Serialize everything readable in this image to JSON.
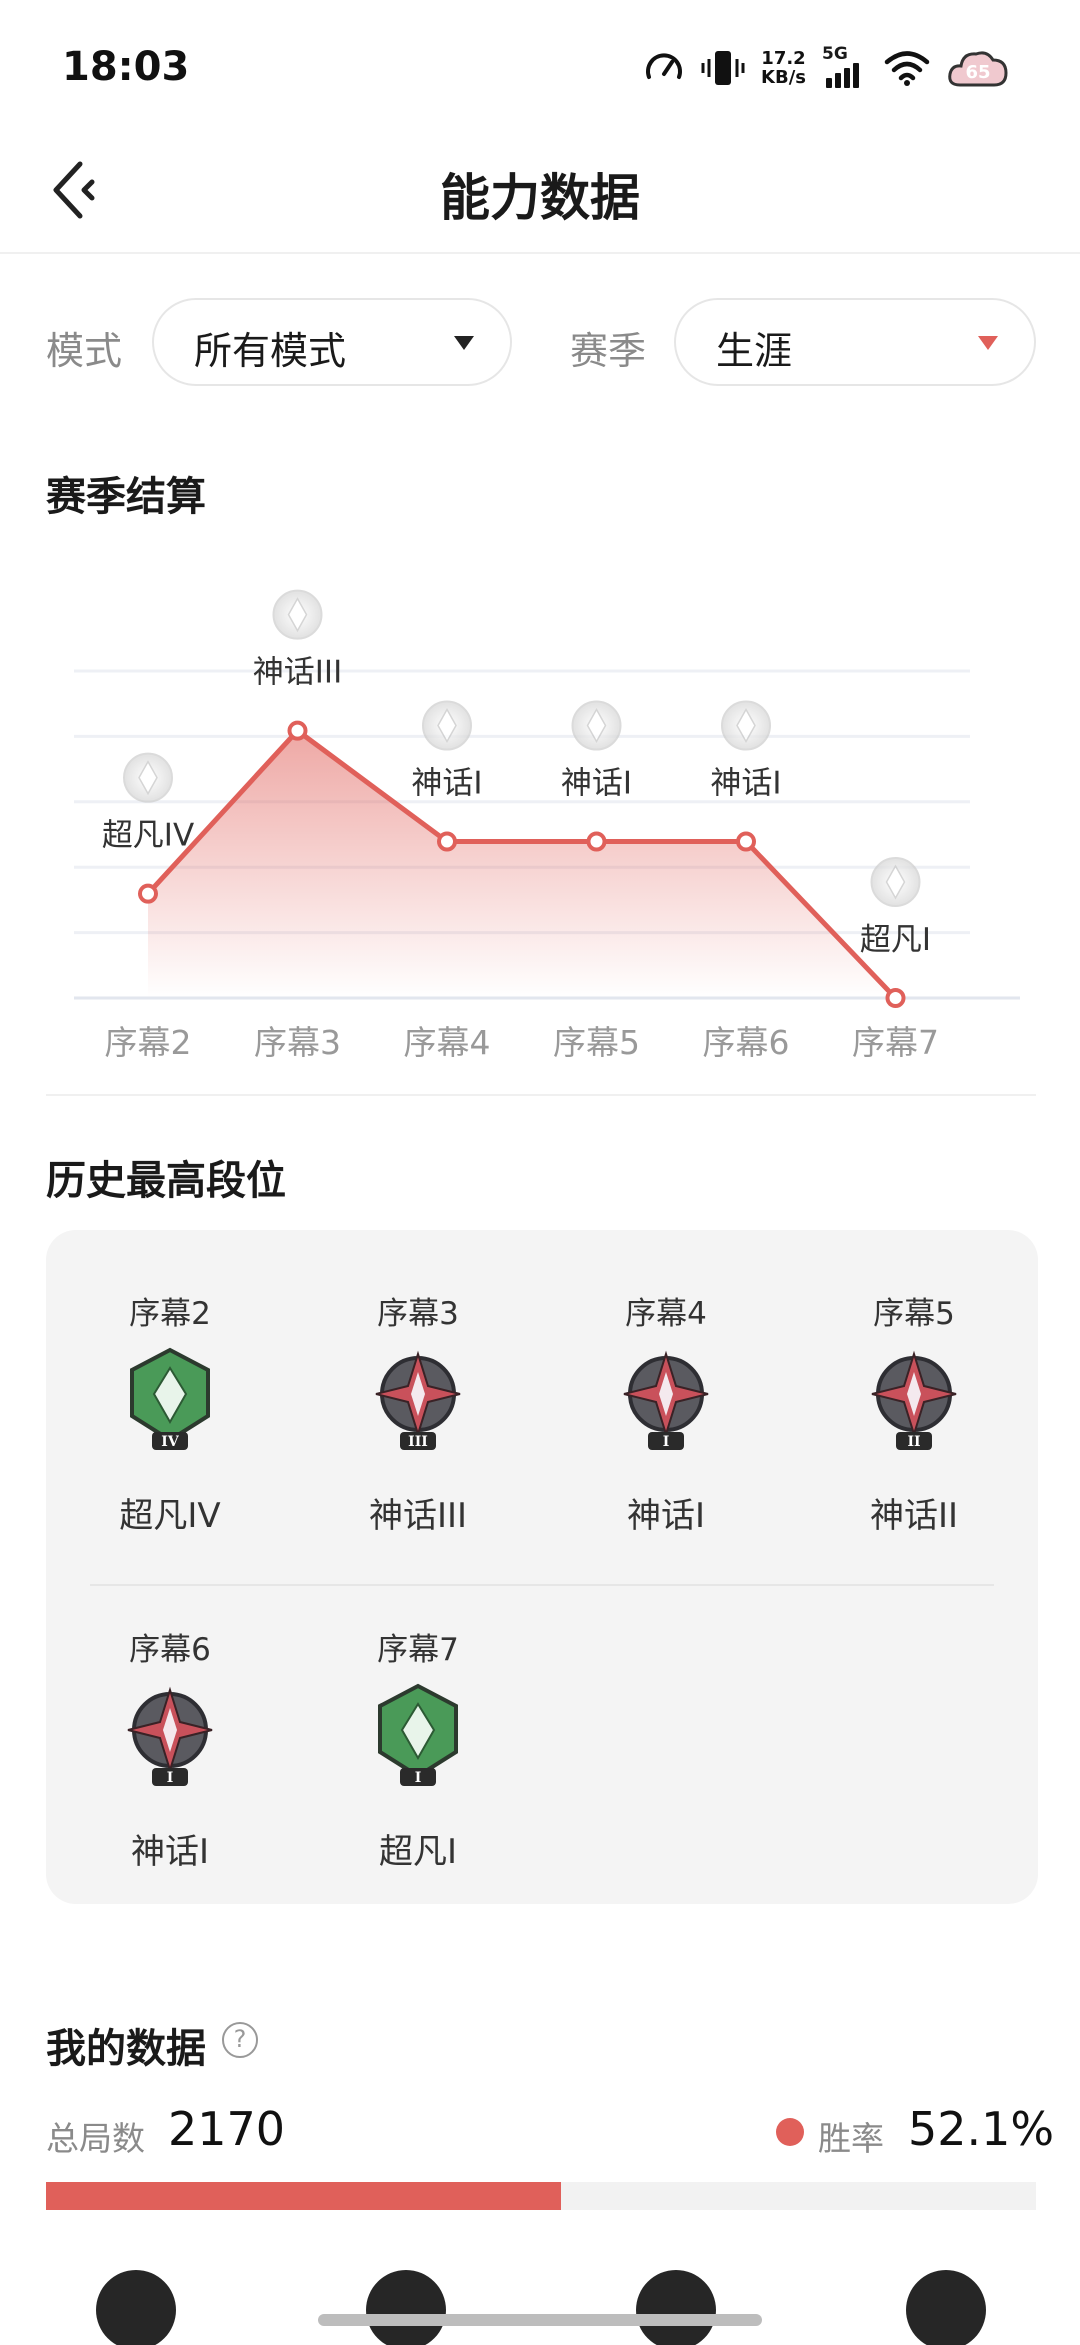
{
  "status_bar": {
    "time": "18:03",
    "net_speed_value": "17.2",
    "net_speed_unit": "KB/s",
    "network_type": "5G",
    "avatar_text": "65"
  },
  "header": {
    "back_icon": "back-arrow-icon",
    "title": "能力数据"
  },
  "filters": {
    "mode_label": "模式",
    "mode_value": "所有模式",
    "season_label": "赛季",
    "season_value": "生涯"
  },
  "season_settlement": {
    "title": "赛季结算"
  },
  "chart_data": {
    "type": "area",
    "categories": [
      "序幕2",
      "序幕3",
      "序幕4",
      "序幕5",
      "序幕6",
      "序幕7"
    ],
    "point_labels": [
      "超凡IV",
      "神话III",
      "神话I",
      "神话I",
      "神话I",
      "超凡I"
    ],
    "rank_levels": [
      1.6,
      4.1,
      2.4,
      2.4,
      2.4,
      0
    ],
    "ylim": [
      0,
      5
    ],
    "grid": true,
    "legend": "none",
    "line_color": "#e0605a",
    "fill_color": "#e0605a"
  },
  "history": {
    "title": "历史最高段位",
    "items": [
      {
        "season": "序幕2",
        "rank": "超凡IV",
        "tier": "超凡",
        "numeral": "IV"
      },
      {
        "season": "序幕3",
        "rank": "神话III",
        "tier": "神话",
        "numeral": "III"
      },
      {
        "season": "序幕4",
        "rank": "神话I",
        "tier": "神话",
        "numeral": "I"
      },
      {
        "season": "序幕5",
        "rank": "神话II",
        "tier": "神话",
        "numeral": "II"
      },
      {
        "season": "序幕6",
        "rank": "神话I",
        "tier": "神话",
        "numeral": "I"
      },
      {
        "season": "序幕7",
        "rank": "超凡I",
        "tier": "超凡",
        "numeral": "I"
      }
    ]
  },
  "my_data": {
    "title": "我的数据",
    "help_icon_text": "?",
    "total_games_label": "总局数",
    "total_games_value": "2170",
    "win_rate_label": "胜率",
    "win_rate_value": "52.1%",
    "progress_fraction": 0.52
  },
  "colors": {
    "accent": "#e0605a",
    "mythic": "#c9515b",
    "transcendent": "#4a9a58"
  }
}
